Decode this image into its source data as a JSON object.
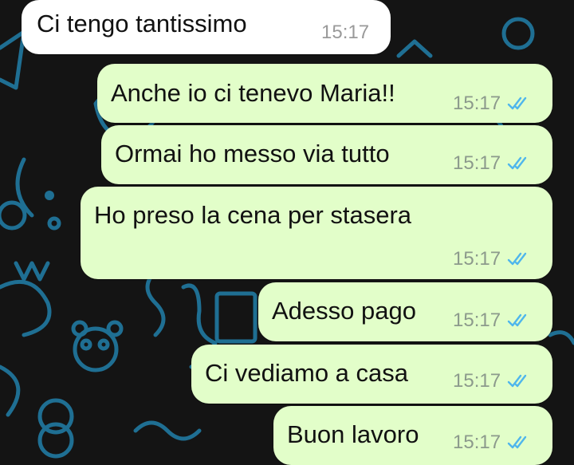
{
  "colors": {
    "incoming_bubble": "#ffffff",
    "outgoing_bubble": "#e2fec9",
    "read_ticks": "#4fb6ec",
    "wallpaper": "#141414",
    "doodle": "#1f6f93"
  },
  "messages": [
    {
      "direction": "incoming",
      "text": "Ci tengo tantissimo",
      "time": "15:17"
    },
    {
      "direction": "outgoing",
      "text": "Anche io ci tenevo Maria!!",
      "time": "15:17",
      "status": "read-double-tick-icon"
    },
    {
      "direction": "outgoing",
      "text": "Ormai ho messo via tutto",
      "time": "15:17",
      "status": "read-double-tick-icon"
    },
    {
      "direction": "outgoing",
      "text": "Ho preso la cena per stasera",
      "time": "15:17",
      "status": "read-double-tick-icon"
    },
    {
      "direction": "outgoing",
      "text": "Adesso pago",
      "time": "15:17",
      "status": "read-double-tick-icon"
    },
    {
      "direction": "outgoing",
      "text": "Ci vediamo a casa",
      "time": "15:17",
      "status": "read-double-tick-icon"
    },
    {
      "direction": "outgoing",
      "text": "Buon lavoro",
      "time": "15:17",
      "status": "read-double-tick-icon"
    }
  ]
}
